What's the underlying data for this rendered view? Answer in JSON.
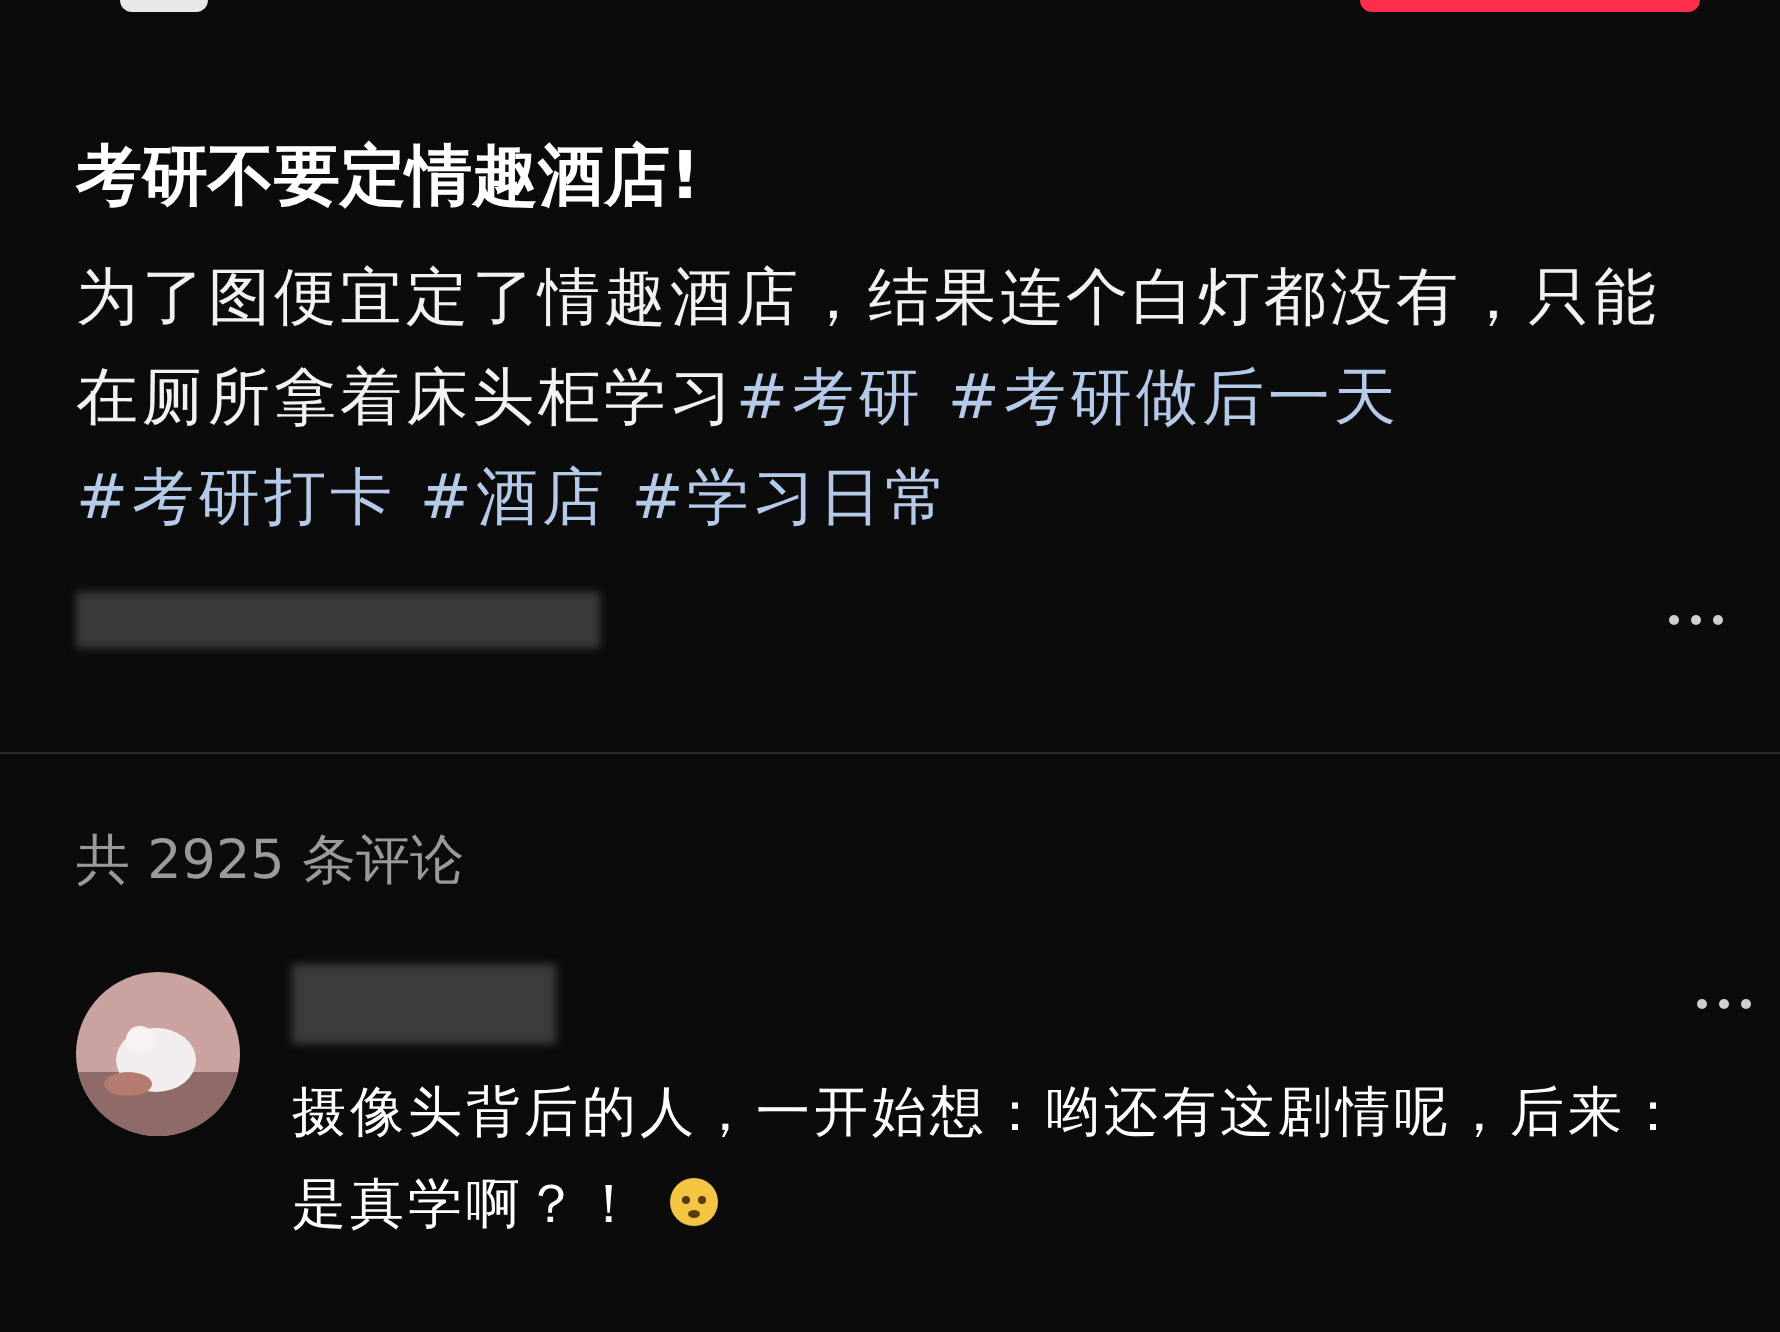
{
  "post": {
    "title": "考研不要定情趣酒店!",
    "body": [
      {
        "kind": "text",
        "text": "为了图便宜定了情趣酒店，结果连个白灯都没有，只能在厕所拿着床头柜学习"
      },
      {
        "kind": "hashtag",
        "text": "#考研"
      },
      {
        "kind": "hashtag",
        "text": "#考研做后一天"
      },
      {
        "kind": "hashtag",
        "text": "#考研打卡"
      },
      {
        "kind": "hashtag",
        "text": "#酒店"
      },
      {
        "kind": "hashtag",
        "text": "#学习日常"
      }
    ]
  },
  "comments_header": {
    "text": "共 2925 条评论"
  },
  "comments": [
    {
      "text": "摄像头背后的人，一开始想：哟还有这剧情呢，后来：是真学啊？！"
    }
  ]
}
